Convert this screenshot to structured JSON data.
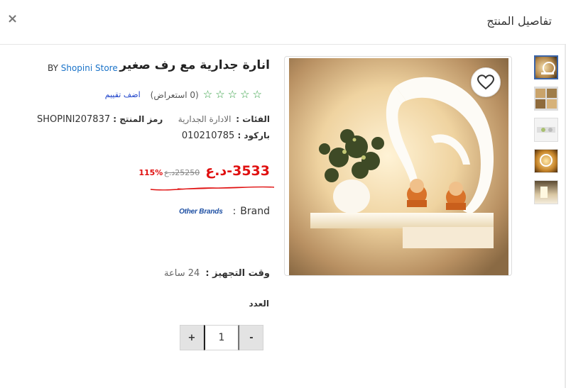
{
  "modal": {
    "title": "تفاصيل المنتج",
    "close_label": "×"
  },
  "product": {
    "title": "انارة جدارية مع رف صغير",
    "by_label": "BY",
    "store": "Shopini Store",
    "rating": 0,
    "reviews_text": "(0 استعراض)",
    "add_review_label": "اضف تقييم",
    "categories_label": "الفئات :",
    "categories_value": "الادارة الجدارية",
    "sku_label": "رمز المنتج :",
    "sku_value": "SHOPINI207837",
    "barcode_label": "باركود :",
    "barcode_value": "010210785",
    "price_current": "3533-د.ع",
    "price_old": "25250د.ع",
    "discount": "115%",
    "brand_label": "Brand",
    "brand_separator": ":",
    "brand_value": "Other Brands",
    "prep_label": "وقت التجهيز :",
    "prep_value": "24 ساعة",
    "quantity_label": "العدد",
    "quantity_value": "1",
    "plus_label": "+",
    "minus_label": "-"
  },
  "colors": {
    "price": "#e01010",
    "star": "#2e9d3e",
    "store_link": "#1a73c9",
    "review_link": "#1a3fc9"
  },
  "icons": {
    "favorite": "heart-outline-icon",
    "close": "close-icon",
    "rating": "star-outline-icon"
  }
}
